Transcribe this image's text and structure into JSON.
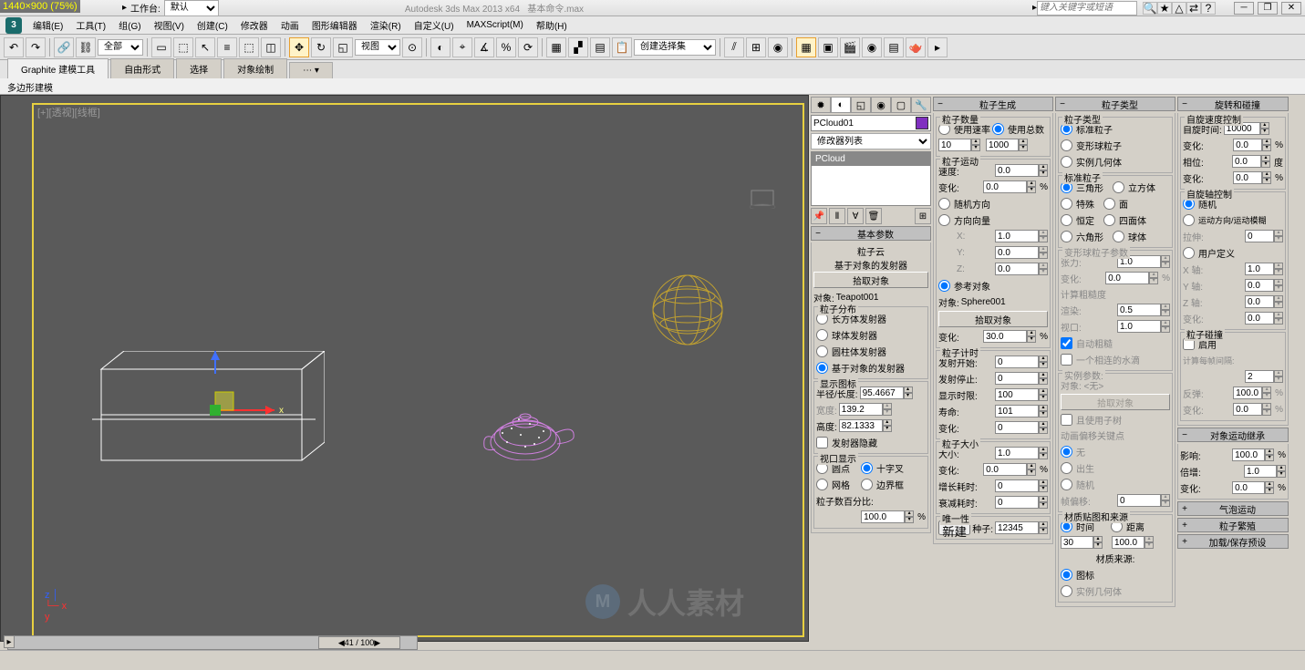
{
  "res_overlay": "1440×900 (75%)",
  "title": {
    "app": "Autodesk 3ds Max  2013  x64",
    "file": "基本命令.max"
  },
  "workspace": {
    "label": "工作台:",
    "value": "默认"
  },
  "search_placeholder": "键入关键字或短语",
  "menus": [
    "编辑(E)",
    "工具(T)",
    "组(G)",
    "视图(V)",
    "创建(C)",
    "修改器",
    "动画",
    "图形编辑器",
    "渲染(R)",
    "自定义(U)",
    "MAXScript(M)",
    "帮助(H)"
  ],
  "toolbar": {
    "all_dropdown": "全部",
    "view_dropdown": "视图",
    "sel_set_dropdown": "创建选择集"
  },
  "tabs": [
    "Graphite 建模工具",
    "自由形式",
    "选择",
    "对象绘制"
  ],
  "subtab": "多边形建模",
  "viewport": {
    "label": "[+][透视][线框]",
    "frame_counter": "41 / 100"
  },
  "object": {
    "name": "PCloud01",
    "modifier": "PCloud",
    "mod_dropdown": "修改器列表"
  },
  "rollouts": {
    "basic": {
      "title": "基本参数",
      "subtitle1": "粒子云",
      "subtitle2": "基于对象的发射器",
      "pick_btn": "拾取对象",
      "object_label": "对象:",
      "object_val": "Teapot001",
      "dist_title": "粒子分布",
      "dist_opts": [
        "长方体发射器",
        "球体发射器",
        "圆柱体发射器",
        "基于对象的发射器"
      ],
      "disp_title": "显示图标",
      "radius_label": "半径/长度:",
      "radius_val": "95.4667",
      "width_label": "宽度:",
      "width_val": "139.2",
      "height_label": "高度:",
      "height_val": "82.1333",
      "hide_emitter": "发射器隐藏",
      "vp_title": "视口显示",
      "vp_opts": [
        "圆点",
        "十字叉",
        "网格",
        "边界框"
      ],
      "pct_label": "粒子数百分比:",
      "pct_val": "100.0"
    },
    "gen": {
      "title": "粒子生成",
      "qty_title": "粒子数量",
      "qty_opts": [
        "使用速率",
        "使用总数"
      ],
      "qty_v1": "10",
      "qty_v2": "1000",
      "motion_title": "粒子运动",
      "speed_label": "速度:",
      "speed_val": "0.0",
      "var_label": "变化:",
      "var_val": "0.0",
      "dir_opts": [
        "随机方向",
        "方向向量"
      ],
      "xyz": {
        "x": "1.0",
        "y": "0.0",
        "z": "0.0"
      },
      "ref_obj": "参考对象",
      "obj_label": "对象:",
      "obj_val": "Sphere001",
      "pick_btn": "拾取对象",
      "var2_label": "变化:",
      "var2_val": "30.0",
      "timing_title": "粒子计时",
      "em_start": "发射开始:",
      "em_start_v": "0",
      "em_stop": "发射停止:",
      "em_stop_v": "0",
      "disp_until": "显示时限:",
      "disp_until_v": "100",
      "life": "寿命:",
      "life_v": "101",
      "life_var": "变化:",
      "life_var_v": "0",
      "size_title": "粒子大小",
      "size": "大小:",
      "size_v": "1.0",
      "size_var": "变化:",
      "size_var_v": "0.0",
      "grow": "增长耗时:",
      "grow_v": "0",
      "fade": "衰减耗时:",
      "fade_v": "0",
      "unique_title": "唯一性",
      "new_btn": "新建",
      "seed_label": "种子:",
      "seed_v": "12345"
    },
    "ptype": {
      "title": "粒子类型",
      "type_title": "粒子类型",
      "type_opts": [
        "标准粒子",
        "变形球粒子",
        "实例几何体"
      ],
      "std_title": "标准粒子",
      "std_opts_l": [
        "三角形",
        "特殊",
        "恒定",
        "六角形"
      ],
      "std_opts_r": [
        "立方体",
        "面",
        "四面体",
        "球体"
      ],
      "meta_title": "变形球粒子参数",
      "tension": "张力:",
      "tension_v": "1.0",
      "tvar": "变化:",
      "tvar_v": "0.0",
      "calc_title": "计算粗糙度",
      "render": "渲染:",
      "render_v": "0.5",
      "vp": "视口:",
      "vp_v": "1.0",
      "auto_rough": "自动粗糙",
      "one_meta": "一个相连的水滴",
      "inst_title": "实例参数:",
      "inst_obj": "对象: <无>",
      "pick_btn": "拾取对象",
      "use_subtree": "且使用子树",
      "anim_title": "动画偏移关键点",
      "anim_opts": [
        "无",
        "出生",
        "随机"
      ],
      "frame_off": "帧偏移:",
      "frame_off_v": "0",
      "mat_title": "材质贴图和来源",
      "mat_opts": [
        "时间",
        "距离"
      ],
      "mat_v1": "30",
      "mat_v2": "100.0",
      "mat_src_title": "材质来源:",
      "mat_src_opts": [
        "图标",
        "实例几何体"
      ]
    },
    "rot": {
      "title": "旋转和碰撞",
      "spin_title": "自旋速度控制",
      "spin_time": "自旋时间:",
      "spin_time_v": "10000",
      "var1": "变化:",
      "var1_v": "0.0",
      "phase": "相位:",
      "phase_v": "0.0",
      "phase_u": "度",
      "var2": "变化:",
      "var2_v": "0.0",
      "axis_title": "自旋轴控制",
      "axis_opts": [
        "随机",
        "运动方向/运动模糊"
      ],
      "stretch": "拉伸:",
      "stretch_v": "0",
      "user_def": "用户定义",
      "x": "X 轴:",
      "xv": "1.0",
      "y": "Y 轴:",
      "yv": "0.0",
      "z": "Z 轴:",
      "zv": "0.0",
      "zvar": "变化:",
      "zvar_v": "0.0",
      "coll_title": "粒子碰撞",
      "enable": "启用",
      "calc_label": "计算每帧间隔:",
      "calc_v": "2",
      "bounce": "反弹:",
      "bounce_v": "100.0",
      "bvar": "变化:",
      "bvar_v": "0.0"
    },
    "inherit": {
      "title": "对象运动继承",
      "affect": "影响:",
      "affect_v": "100.0",
      "mult": "倍增:",
      "mult_v": "1.0",
      "var": "变化:",
      "var_v": "0.0"
    },
    "extra": [
      "气泡运动",
      "粒子繁殖",
      "加载/保存预设"
    ]
  },
  "watermark": "人人素材"
}
